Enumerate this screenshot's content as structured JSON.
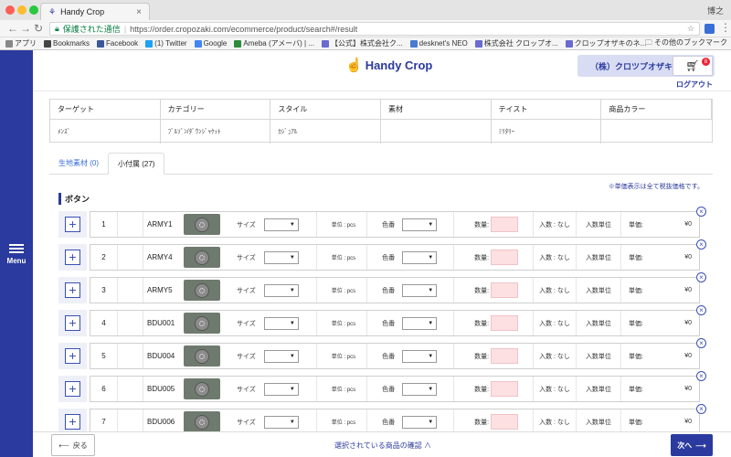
{
  "browser": {
    "tab_title": "Handy Crop",
    "user_name": "博之",
    "secure_label": "保護された通信",
    "url": "https://order.cropozaki.com/ecommerce/product/search#/result"
  },
  "bookmarks": [
    {
      "label": "アプリ",
      "icon": "apps-grid-icon",
      "color": "#888888"
    },
    {
      "label": "Bookmarks",
      "icon": "star-icon",
      "color": "#444444"
    },
    {
      "label": "Facebook",
      "icon": "facebook-icon",
      "color": "#3b5998"
    },
    {
      "label": "(1) Twitter",
      "icon": "twitter-icon",
      "color": "#1da1f2"
    },
    {
      "label": "Google",
      "icon": "google-icon",
      "color": "#4285f4"
    },
    {
      "label": "Ameba (アメーバ) | ...",
      "icon": "ameba-icon",
      "color": "#2d8c3c"
    },
    {
      "label": "【公式】株式会社ク...",
      "icon": "globe-icon",
      "color": "#6a6ad0"
    },
    {
      "label": "desknet's NEO",
      "icon": "desknets-icon",
      "color": "#4a7bd0"
    },
    {
      "label": "株式会社 クロップオ...",
      "icon": "globe-icon",
      "color": "#6a6ad0"
    },
    {
      "label": "クロップオザキのネ...",
      "icon": "globe-icon",
      "color": "#6a6ad0"
    }
  ],
  "bookmarks_other": "その他のブックマーク",
  "sidebar": {
    "menu_label": "Menu"
  },
  "header": {
    "logo_text": "Handy Crop",
    "account_name": "（株）クロツプオザキ 様",
    "cart_count": "8",
    "logout": "ログアウト"
  },
  "filters": {
    "headers": [
      "ターゲット",
      "カテゴリー",
      "スタイル",
      "素材",
      "テイスト",
      "商品カラー"
    ],
    "values": [
      "ﾒﾝｽﾞ",
      "ﾌﾞﾙｿﾞﾝ/ﾀﾞｳﾝｼﾞｬｹｯﾄ",
      "ｶｼﾞｭｱﾙ",
      "",
      "ﾐﾘﾀﾘｰ",
      ""
    ]
  },
  "tabs": [
    {
      "label": "生地素材 (0)",
      "active": false
    },
    {
      "label": "小付属 (27)",
      "active": true
    }
  ],
  "price_note": "※単価表示は全て税抜価格です。",
  "section_title": "ボタン",
  "row_labels": {
    "size": "サイズ",
    "unit": "単位 : pcs",
    "color_no": "色番",
    "qty": "数量:",
    "irisu": "入数 : なし",
    "irisu_unit": "入数単位",
    "unit_price": "単価:"
  },
  "products": [
    {
      "no": "1",
      "code": "ARMY1",
      "price": "¥0"
    },
    {
      "no": "2",
      "code": "ARMY4",
      "price": "¥0"
    },
    {
      "no": "3",
      "code": "ARMY5",
      "price": "¥0"
    },
    {
      "no": "4",
      "code": "BDU001",
      "price": "¥0"
    },
    {
      "no": "5",
      "code": "BDU004",
      "price": "¥0"
    },
    {
      "no": "6",
      "code": "BDU005",
      "price": "¥0"
    },
    {
      "no": "7",
      "code": "BDU006",
      "price": "¥0"
    }
  ],
  "footer": {
    "back": "戻る",
    "confirm": "選択されている商品の確認 ∧",
    "next": "次へ"
  }
}
